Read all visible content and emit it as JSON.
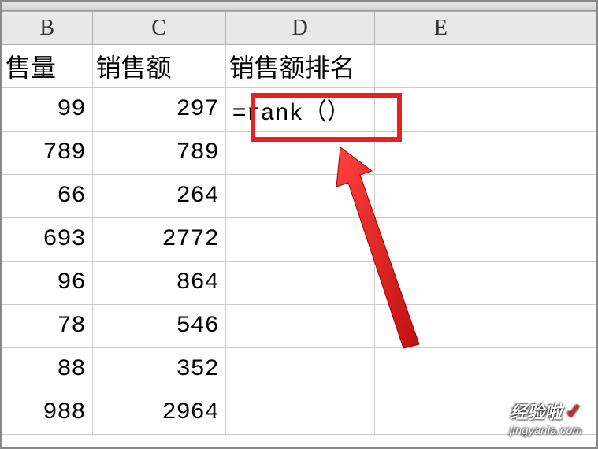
{
  "columns": {
    "b": "B",
    "c": "C",
    "d": "D",
    "e": "E"
  },
  "headers": {
    "b": "售量",
    "c": "销售额",
    "d": "销售额排名"
  },
  "formula": "=rank（）",
  "rows": [
    {
      "b": "99",
      "c": "297"
    },
    {
      "b": "789",
      "c": "789"
    },
    {
      "b": "66",
      "c": "264"
    },
    {
      "b": "693",
      "c": "2772"
    },
    {
      "b": "96",
      "c": "864"
    },
    {
      "b": "78",
      "c": "546"
    },
    {
      "b": "88",
      "c": "352"
    },
    {
      "b": "988",
      "c": "2964"
    }
  ],
  "watermark": {
    "brand": "经验啦",
    "url": "jingyanla.com"
  },
  "chart_data": {
    "type": "table",
    "title": "销售额排名",
    "columns": [
      "售量",
      "销售额",
      "销售额排名"
    ],
    "data": [
      [
        99,
        297,
        "=rank（）"
      ],
      [
        789,
        789,
        null
      ],
      [
        66,
        264,
        null
      ],
      [
        693,
        2772,
        null
      ],
      [
        96,
        864,
        null
      ],
      [
        78,
        546,
        null
      ],
      [
        88,
        352,
        null
      ],
      [
        988,
        2964,
        null
      ]
    ]
  }
}
